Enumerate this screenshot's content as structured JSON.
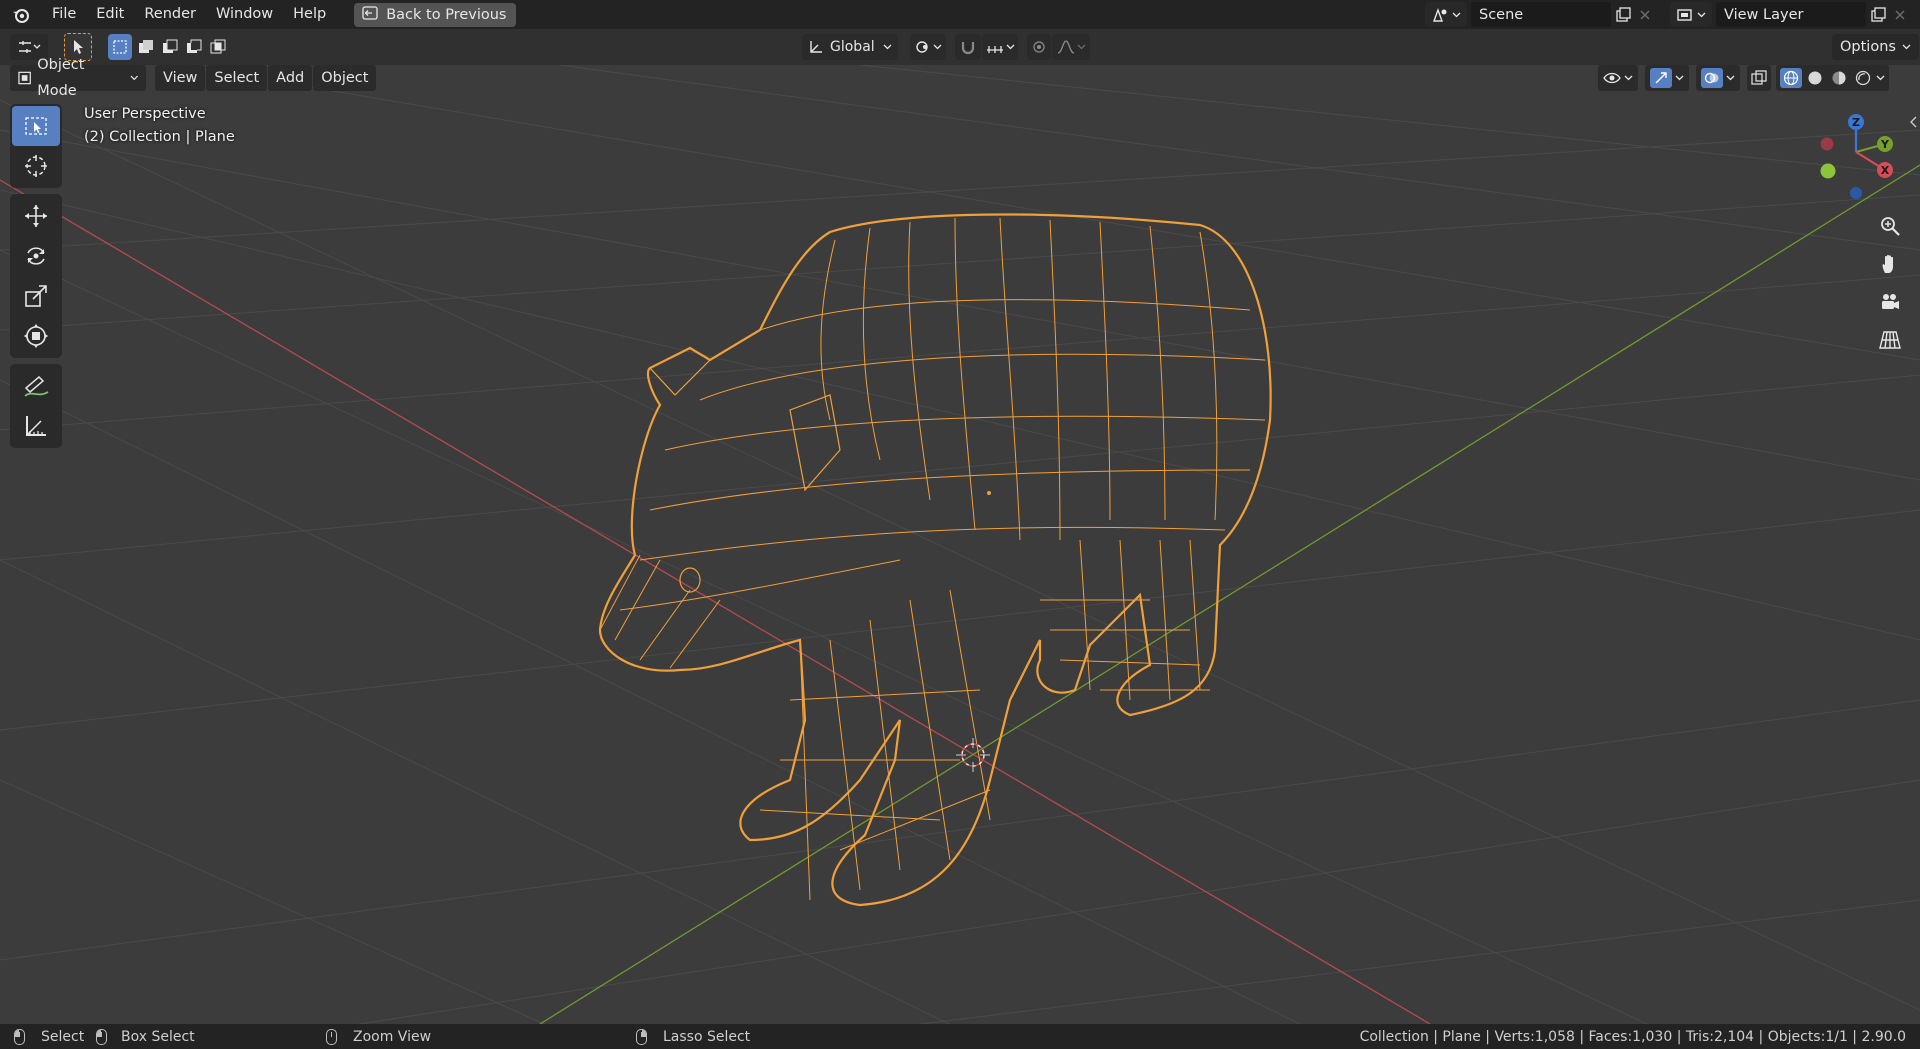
{
  "menu": {
    "items": [
      "File",
      "Edit",
      "Render",
      "Window",
      "Help"
    ],
    "back_button": "Back to Previous"
  },
  "scene": {
    "label": "Scene"
  },
  "view_layer": {
    "label": "View Layer"
  },
  "toolbar": {
    "orientation": "Global",
    "options_label": "Options"
  },
  "header": {
    "mode": "Object Mode",
    "menus": [
      "View",
      "Select",
      "Add",
      "Object"
    ]
  },
  "viewport": {
    "perspective": "User Perspective",
    "collection_info": "(2) Collection | Plane",
    "wire_color": "#f0a03a",
    "background": "#3c3c3c"
  },
  "gizmo": {
    "z": "Z",
    "y": "Y",
    "x": "X"
  },
  "tools": [
    "select-box",
    "cursor",
    "move",
    "rotate",
    "scale",
    "transform",
    "annotate",
    "measure"
  ],
  "statusbar": {
    "select": "Select",
    "box_select": "Box Select",
    "zoom_view": "Zoom View",
    "lasso_select": "Lasso Select",
    "stats": "Collection | Plane | Verts:1,058 | Faces:1,030 | Tris:2,104 | Objects:1/1 | 2.90.0"
  }
}
